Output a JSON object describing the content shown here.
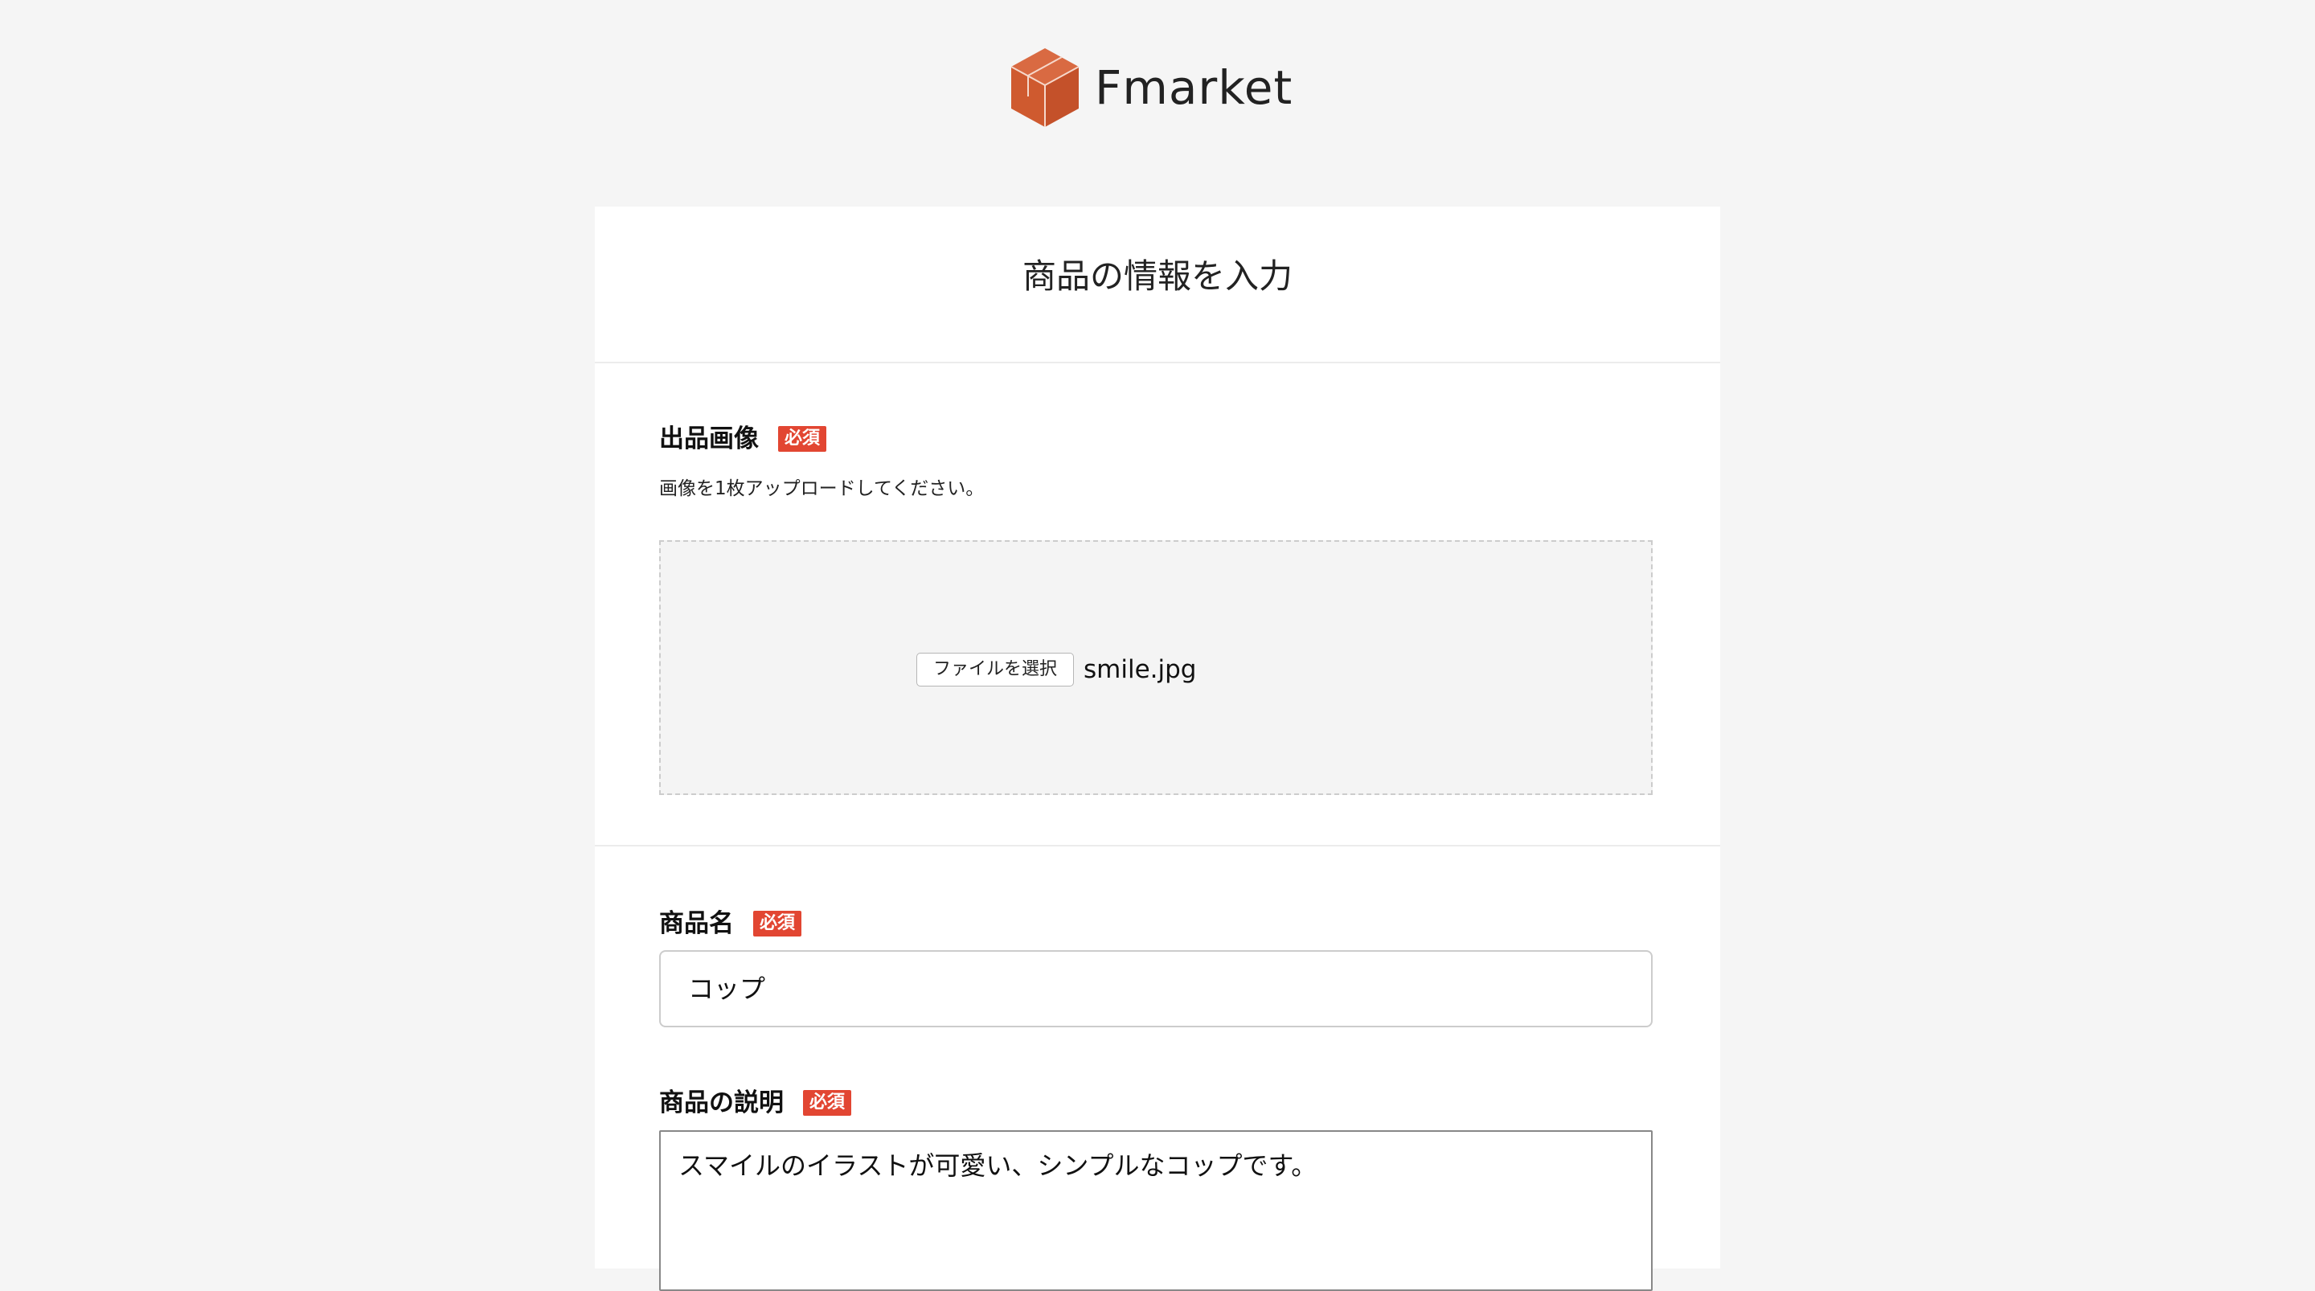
{
  "header": {
    "logo_text": "Fmarket",
    "logo_color": "#d3582f",
    "icon": "cube-icon"
  },
  "form": {
    "title": "商品の情報を入力",
    "required_label": "必須",
    "required_color": "#e24632",
    "image_section": {
      "label": "出品画像",
      "hint": "画像を1枚アップロードしてください。",
      "file_button_label": "ファイルを選択",
      "file_name": "smile.jpg"
    },
    "name_section": {
      "label": "商品名",
      "value": "コップ"
    },
    "description_section": {
      "label": "商品の説明",
      "value": "スマイルのイラストが可愛い、シンプルなコップです。"
    }
  }
}
